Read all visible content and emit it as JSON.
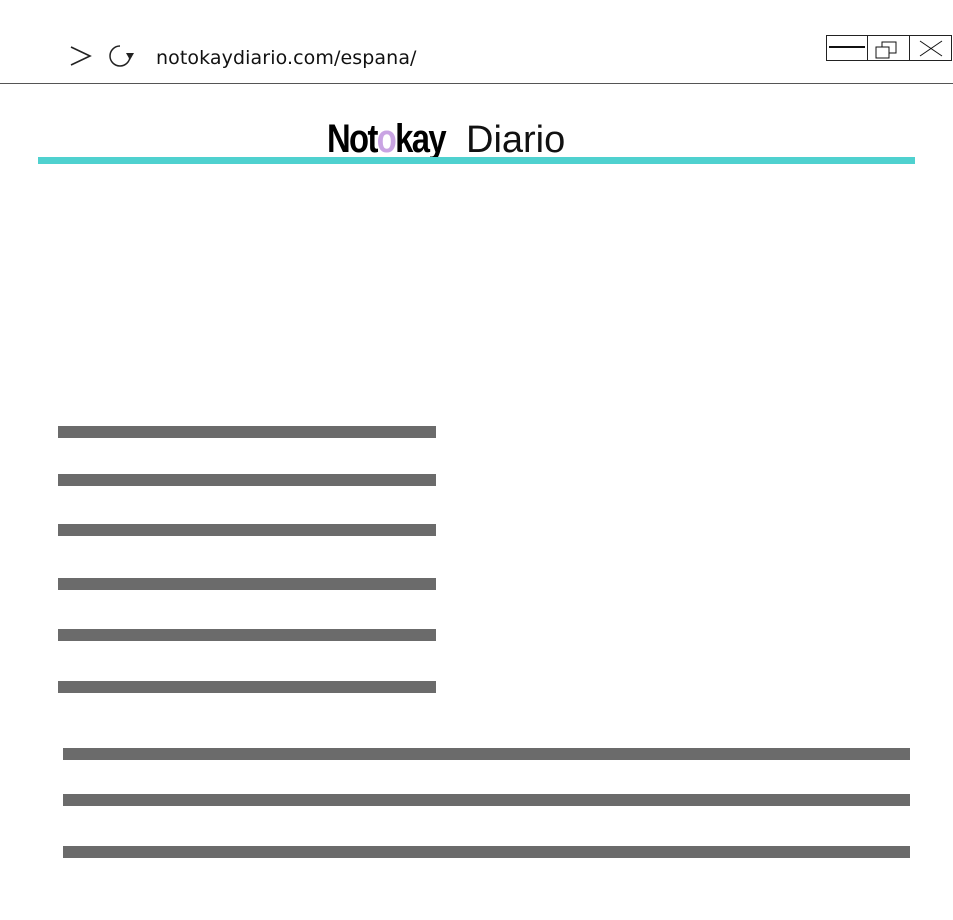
{
  "browser": {
    "url": "notokaydiario.com/espana/",
    "icons": {
      "forward": "chevron-right-icon",
      "reload": "reload-icon",
      "minimize": "minimize-icon",
      "restore": "restore-icon",
      "close": "close-icon"
    }
  },
  "site": {
    "logo": {
      "part1": "Not",
      "accent_letter": "o",
      "part2": "kay",
      "light": "Diario"
    },
    "colors": {
      "accent_rule": "#4fd1cf",
      "logo_accent": "#c9a4e3",
      "placeholder_bar": "#6b6b6b"
    }
  },
  "content": {
    "short_bar_count": 6,
    "long_bar_count": 3
  }
}
